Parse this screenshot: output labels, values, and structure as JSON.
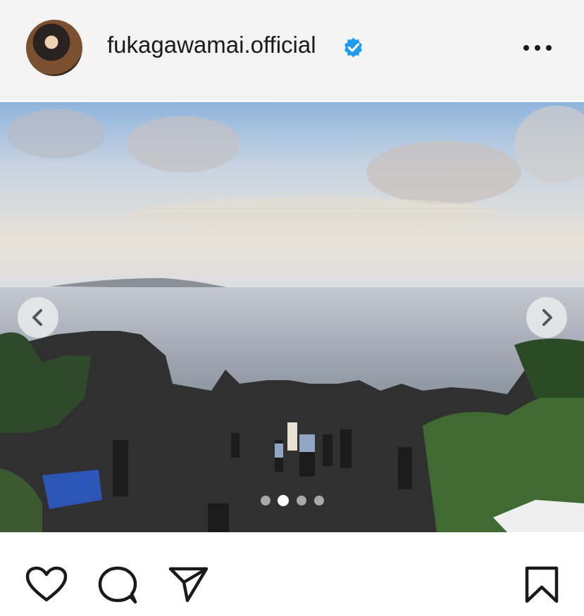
{
  "post": {
    "username": "fukagawamai.official",
    "verified": true,
    "avatar_icon": "profile-photo",
    "more_icon": "more-options-icon",
    "carousel": {
      "total": 4,
      "current": 2
    },
    "media_description_icon": "coastal-landscape-photo",
    "actions": {
      "like_icon": "heart-icon",
      "comment_icon": "comment-icon",
      "share_icon": "share-icon",
      "save_icon": "bookmark-icon"
    },
    "colors": {
      "verified_badge": "#1d9bf0",
      "text": "#1a1a1a"
    }
  }
}
